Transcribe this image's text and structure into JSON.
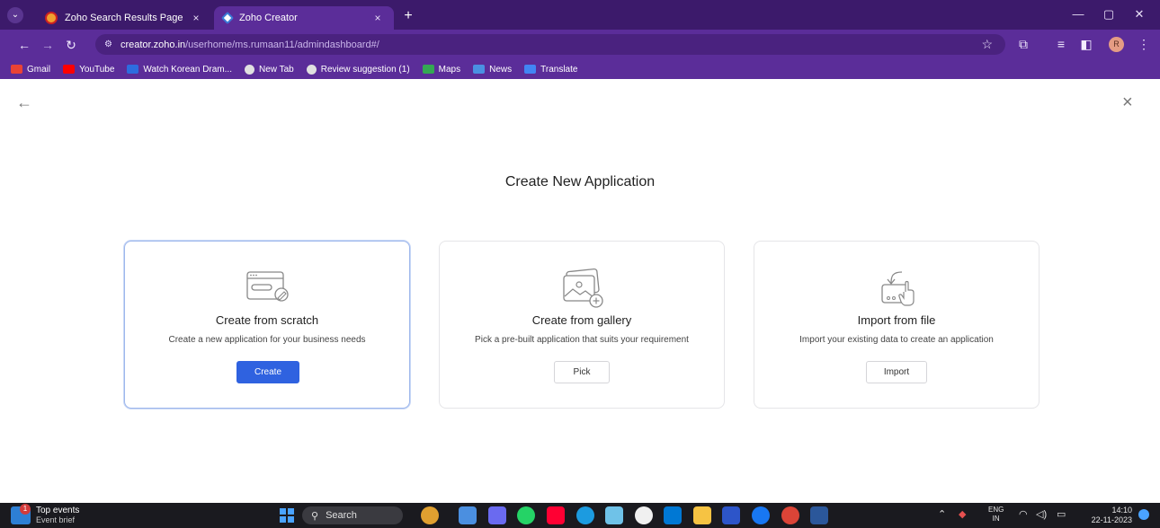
{
  "browser": {
    "tabs": [
      {
        "title": "Zoho Search Results Page",
        "close": "×"
      },
      {
        "title": "Zoho Creator",
        "close": "×"
      }
    ],
    "new_tab": "+",
    "url_host": "creator.zoho.in",
    "url_path": "/userhome/ms.rumaan11/admindashboard#/",
    "profile_initial": "R",
    "bookmarks": [
      "Gmail",
      "YouTube",
      "Watch Korean Dram...",
      "New Tab",
      "Review suggestion (1)",
      "Maps",
      "News",
      "Translate"
    ]
  },
  "page": {
    "title": "Create New Application",
    "cards": [
      {
        "title": "Create from scratch",
        "desc": "Create a new application for your business needs",
        "button": "Create"
      },
      {
        "title": "Create from gallery",
        "desc": "Pick a pre-built application that suits your requirement",
        "button": "Pick"
      },
      {
        "title": "Import from file",
        "desc": "Import your existing data to create an application",
        "button": "Import"
      }
    ]
  },
  "taskbar": {
    "weather_title": "Top events",
    "weather_sub": "Event brief",
    "weather_badge": "1",
    "search_label": "Search",
    "lang_top": "ENG",
    "lang_bottom": "IN",
    "time": "14:10",
    "date": "22-11-2023"
  },
  "colors": {
    "browser_frame": "#5b2d99",
    "tab_strip": "#3c1a6b",
    "primary_button": "#2f62e0",
    "selected_card_border": "#9fb8ec"
  }
}
